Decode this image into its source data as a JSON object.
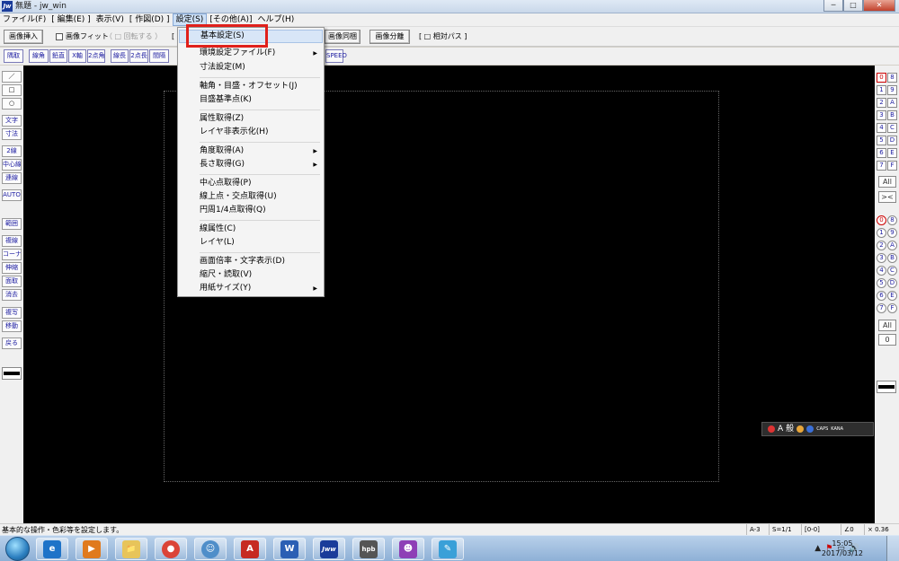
{
  "window": {
    "title": "無題 - jw_win",
    "app_icon": "Jw",
    "minimize_label": "─",
    "maximize_label": "□",
    "close_label": "✕"
  },
  "menubar": [
    "ファイル(F)",
    "[ 編集(E) ]",
    "表示(V)",
    "[ 作図(D) ]",
    "設定(S)",
    "[その他(A)]",
    "ヘルプ(H)"
  ],
  "toolbar1": {
    "insert_image": "画像挿入",
    "fit_image": "画像フィット",
    "rotate": "（ □ 回転する ）",
    "bracket_left": "[",
    "image_sync": "画像同梱",
    "image_split": "画像分離",
    "relative_path": "[ □ 相対パス ]"
  },
  "toolbar2": [
    "隅取",
    "線角",
    "鉛直",
    "X軸",
    "2点角",
    "線長",
    "2点長",
    "間隔",
    "SPEED"
  ],
  "left_tools": {
    "row1": [
      "／",
      "□",
      "○"
    ],
    "row2": [
      "文字",
      "寸法",
      "2線",
      "中心線",
      "連線",
      "AUTO"
    ],
    "row3": [
      "範囲",
      "複線",
      "コーナー",
      "伸縮",
      "面取",
      "消去",
      "複写",
      "移動",
      "戻る"
    ]
  },
  "right_tools": {
    "layer_groups": [
      [
        "0",
        "8"
      ],
      [
        "1",
        "9"
      ],
      [
        "2",
        "A"
      ],
      [
        "3",
        "B"
      ],
      [
        "4",
        "C"
      ],
      [
        "5",
        "D"
      ],
      [
        "6",
        "E"
      ],
      [
        "7",
        "F"
      ]
    ],
    "all_label": "All",
    "swap_label": "><",
    "layers": [
      [
        "0",
        "8"
      ],
      [
        "1",
        "9"
      ],
      [
        "2",
        "A"
      ],
      [
        "3",
        "B"
      ],
      [
        "4",
        "C"
      ],
      [
        "5",
        "D"
      ],
      [
        "6",
        "E"
      ],
      [
        "7",
        "F"
      ]
    ],
    "all_label_2": "All",
    "zero_label": "0"
  },
  "settings_menu": {
    "items": [
      {
        "label": "基本設定(S)",
        "submenu": false,
        "highlighted": true
      },
      {
        "label": "環境設定ファイル(F)",
        "submenu": true
      },
      {
        "label": "寸法設定(M)",
        "submenu": false
      },
      {
        "label": "軸角・目盛・オフセット(J)",
        "submenu": false
      },
      {
        "label": "目盛基準点(K)",
        "submenu": false
      },
      {
        "label": "属性取得(Z)",
        "submenu": false
      },
      {
        "label": "レイヤ非表示化(H)",
        "submenu": false
      },
      {
        "label": "角度取得(A)",
        "submenu": true
      },
      {
        "label": "長さ取得(G)",
        "submenu": true
      },
      {
        "label": "中心点取得(P)",
        "submenu": false
      },
      {
        "label": "線上点・交点取得(U)",
        "submenu": false
      },
      {
        "label": "円周1/4点取得(Q)",
        "submenu": false
      },
      {
        "label": "線属性(C)",
        "submenu": false
      },
      {
        "label": "レイヤ(L)",
        "submenu": false
      },
      {
        "label": "画面倍率・文字表示(D)",
        "submenu": false
      },
      {
        "label": "縮尺・読取(V)",
        "submenu": false
      },
      {
        "label": "用紙サイズ(Y)",
        "submenu": true
      }
    ],
    "arrow": "▶"
  },
  "ime_bar": {
    "a_label": "A",
    "mode_label": "般",
    "caps": "CAPS",
    "kana": "KANA"
  },
  "status": {
    "message": "基本的な操作・色彩等を設定します。",
    "paper": "A-3",
    "scale": "S=1/1",
    "layer": "[0-0]",
    "angle": "∠0",
    "zoom": "× 0.36"
  },
  "taskbar": {
    "apps": [
      "e",
      "▶",
      "📁",
      "●",
      "☺",
      "A",
      "W",
      "Jww",
      "hpb",
      "☻",
      "✎"
    ],
    "tray_icons": [
      "▲",
      "⚑",
      "▭",
      "🔊"
    ],
    "time": "15:05",
    "date": "2017/03/12"
  },
  "colors": {
    "accent_red": "#e0201b",
    "canvas": "#000000",
    "layer_text": "#1a1aa0"
  }
}
